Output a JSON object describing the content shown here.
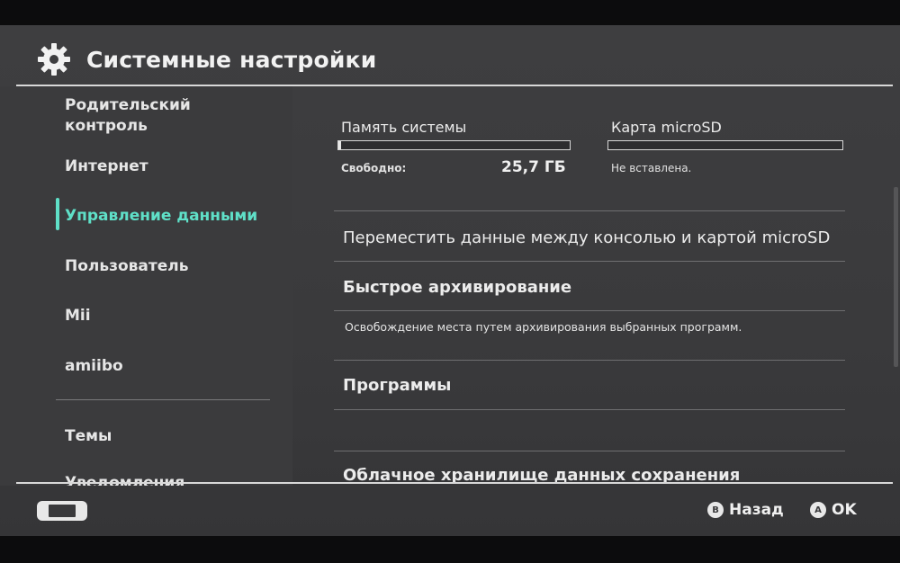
{
  "header": {
    "title": "Системные настройки"
  },
  "sidebar": {
    "items": [
      {
        "label_line1": "Родительский",
        "label_line2": "контроль"
      },
      {
        "label": "Интернет"
      },
      {
        "label": "Управление данными",
        "active": true
      },
      {
        "label": "Пользователь"
      },
      {
        "label": "Mii"
      },
      {
        "label": "amiibo"
      },
      {
        "label": "Темы"
      },
      {
        "label": "Уведомления"
      }
    ]
  },
  "storage": {
    "system": {
      "label": "Память системы",
      "free_label": "Свободно:",
      "free_value": "25,7 ГБ",
      "used_fraction": 0.01
    },
    "microsd": {
      "label": "Карта microSD",
      "status": "Не вставлена."
    }
  },
  "menu": {
    "move_data": "Переместить данные между консолью и картой microSD",
    "quick_archive": "Быстрое архивирование",
    "quick_archive_desc": "Освобождение места путем архивирования выбранных программ.",
    "programs": "Программы",
    "cloud_saves": "Облачное хранилище данных сохранения"
  },
  "footer": {
    "back_key": "B",
    "back_label": "Назад",
    "ok_key": "A",
    "ok_label": "OK"
  },
  "colors": {
    "accent": "#5fe0c8",
    "background": "#3b3b3d"
  }
}
